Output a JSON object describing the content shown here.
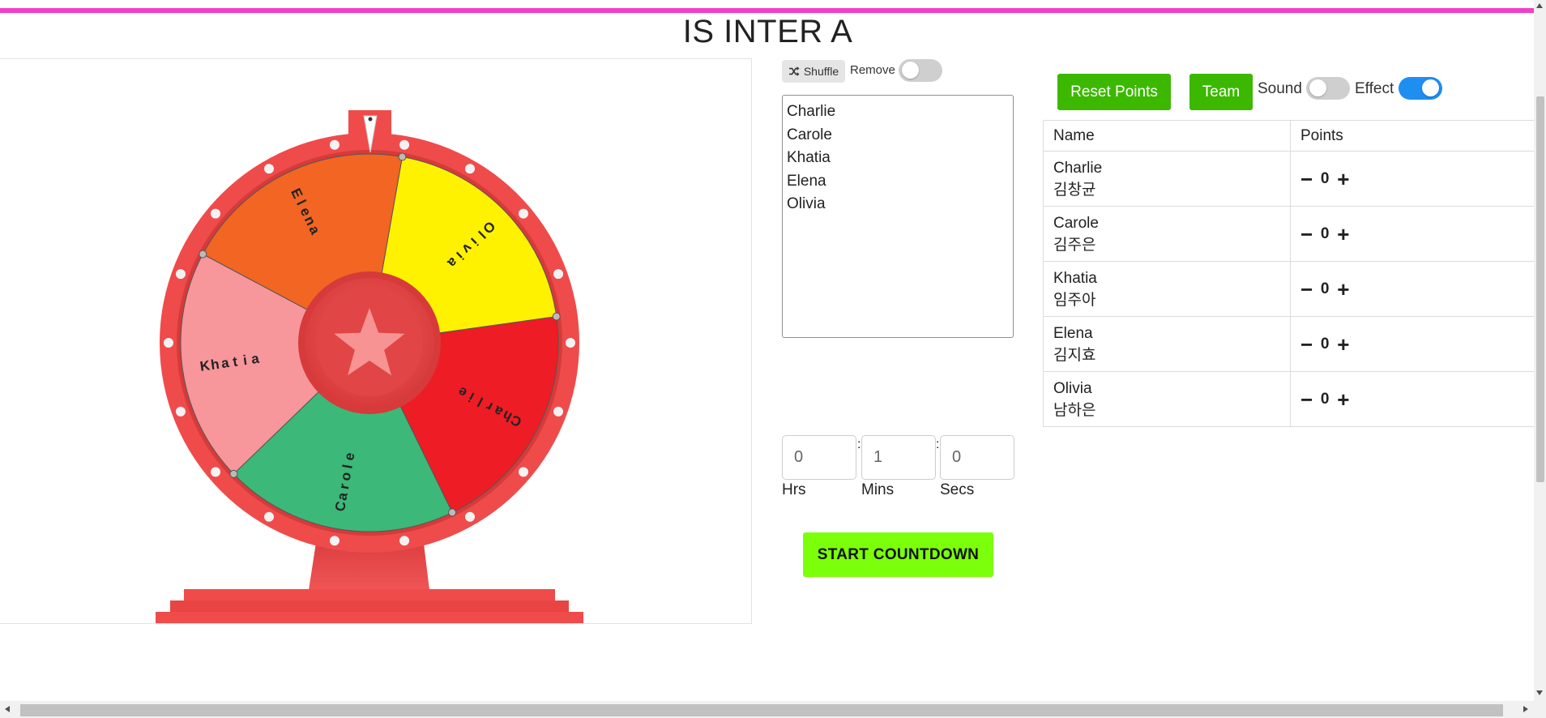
{
  "title": "IS INTER A",
  "wheel": {
    "segments": [
      {
        "label": "Olivia",
        "color": "#fff200"
      },
      {
        "label": "Charlie",
        "color": "#ee1c25"
      },
      {
        "label": "Carole",
        "color": "#3cb878"
      },
      {
        "label": "Khatia",
        "color": "#f7969b"
      },
      {
        "label": "Elena",
        "color": "#f26522"
      }
    ],
    "rim_color": "#ef4b4b",
    "pointer_icon": "pointer-icon",
    "center_icon": "star-icon"
  },
  "controls": {
    "shuffle_label": "Shuffle",
    "shuffle_icon": "shuffle-icon",
    "remove_label": "Remove",
    "remove_on": false
  },
  "names_list": [
    "Charlie",
    "Carole",
    "Khatia",
    "Elena",
    "Olivia"
  ],
  "timer": {
    "hours": "0",
    "minutes": "1",
    "seconds": "0",
    "hours_label": "Hrs",
    "minutes_label": "Mins",
    "seconds_label": "Secs",
    "separator": ":",
    "start_label": "START COUNTDOWN"
  },
  "right_panel": {
    "reset_label": "Reset Points",
    "team_label": "Team",
    "sound_label": "Sound",
    "sound_on": false,
    "effect_label": "Effect",
    "effect_on": true
  },
  "points_table": {
    "headers": [
      "Name",
      "Points"
    ],
    "rows": [
      {
        "name": "Charlie",
        "korean": "김창균",
        "points": "0"
      },
      {
        "name": "Carole",
        "korean": "김주은",
        "points": "0"
      },
      {
        "name": "Khatia",
        "korean": "임주아",
        "points": "0"
      },
      {
        "name": "Elena",
        "korean": "김지효",
        "points": "0"
      },
      {
        "name": "Olivia",
        "korean": "남하은",
        "points": "0"
      }
    ],
    "minus_symbol": "−",
    "plus_symbol": "+"
  },
  "colors": {
    "accent_bar": "#ef3fc9",
    "start_button": "#7cff0a",
    "green_button": "#3cb800",
    "toggle_on": "#1f8ef1"
  }
}
